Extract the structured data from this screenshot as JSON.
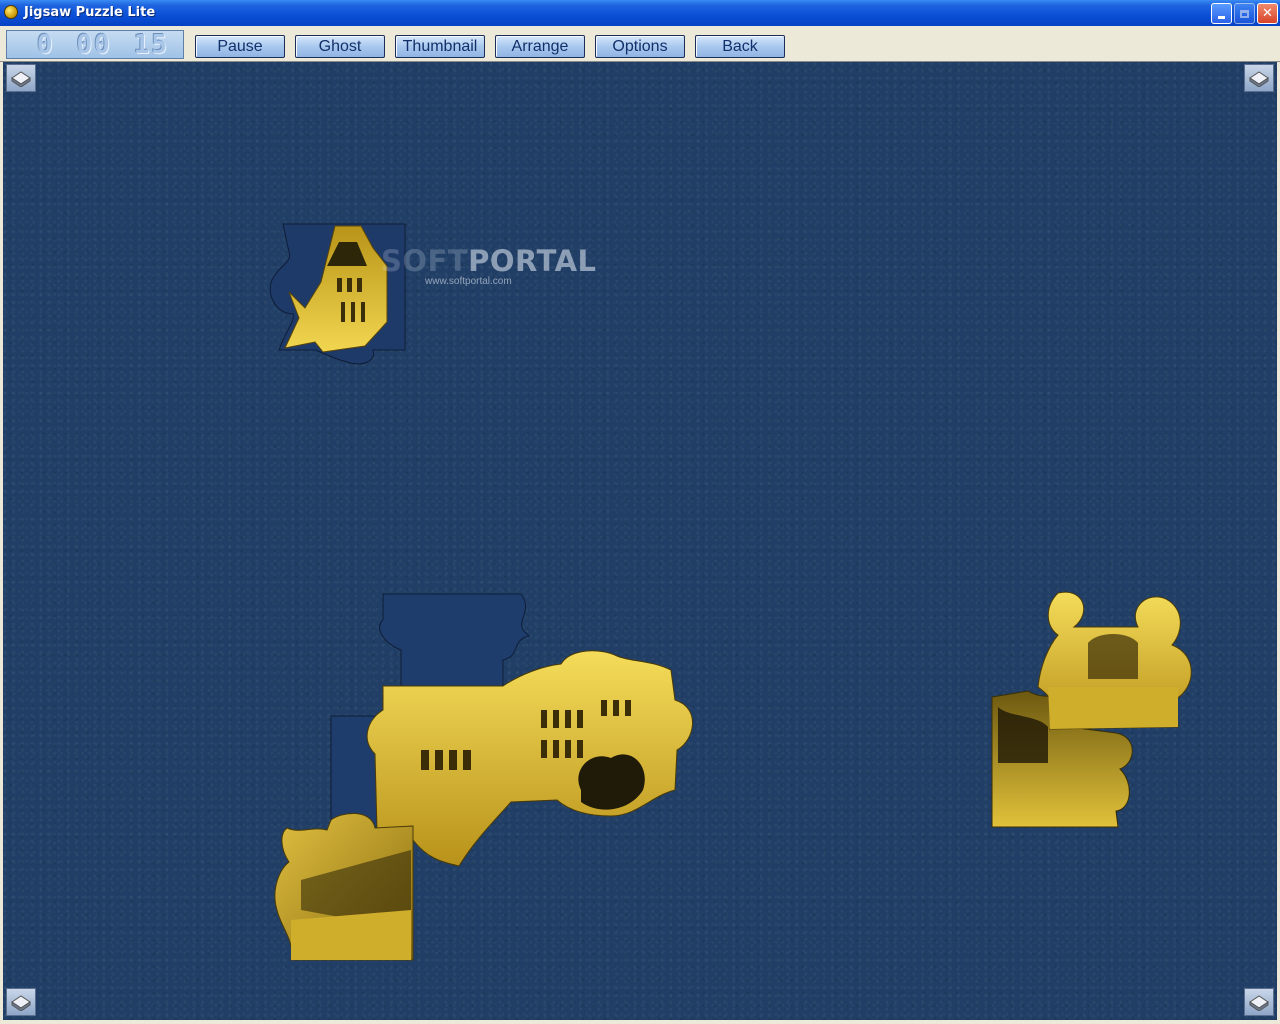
{
  "window": {
    "title": "Jigsaw Puzzle Lite"
  },
  "timer": {
    "hours": "0",
    "minutes": "00",
    "seconds": "15"
  },
  "toolbar": {
    "buttons": [
      "Pause",
      "Ghost",
      "Thumbnail",
      "Arrange",
      "Options",
      "Back"
    ]
  },
  "watermark": {
    "brand_left": "SOFT",
    "brand_right": "PORTAL",
    "url": "www.softportal.com"
  },
  "colors": {
    "board": "#213f66",
    "piece_gold": "#d9b52a",
    "piece_dark": "#3a2f08",
    "toolbar": "#ece9d8"
  },
  "icons": {
    "app": "jigsaw-app-icon",
    "corners": "piece-tray-icon"
  }
}
